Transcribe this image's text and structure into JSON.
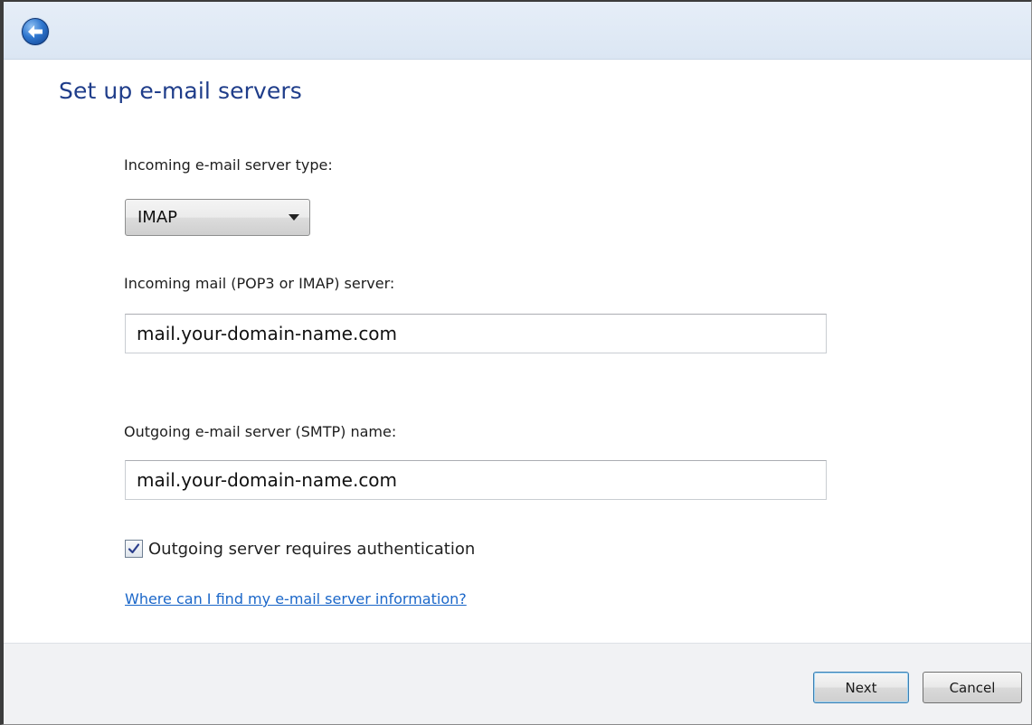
{
  "title_bar": {
    "back_icon": "back-arrow-icon"
  },
  "page": {
    "title": "Set up e-mail servers"
  },
  "form": {
    "server_type": {
      "label": "Incoming e-mail server type:",
      "selected": "IMAP",
      "dropdown_icon": "chevron-down-icon"
    },
    "incoming": {
      "label": "Incoming mail (POP3 or IMAP) server:",
      "value": "mail.your-domain-name.com"
    },
    "outgoing": {
      "label": "Outgoing e-mail server (SMTP) name:",
      "value": "mail.your-domain-name.com"
    },
    "auth": {
      "label": "Outgoing server requires authentication",
      "checked": true,
      "check_icon": "checkmark-icon"
    },
    "help_link": "Where can I find my e-mail server information?"
  },
  "footer": {
    "next_label": "Next",
    "cancel_label": "Cancel"
  },
  "colors": {
    "title": "#1f3d8a",
    "link": "#1b67c9",
    "title_bar": "#dbe6f3",
    "footer": "#f1f2f4"
  }
}
